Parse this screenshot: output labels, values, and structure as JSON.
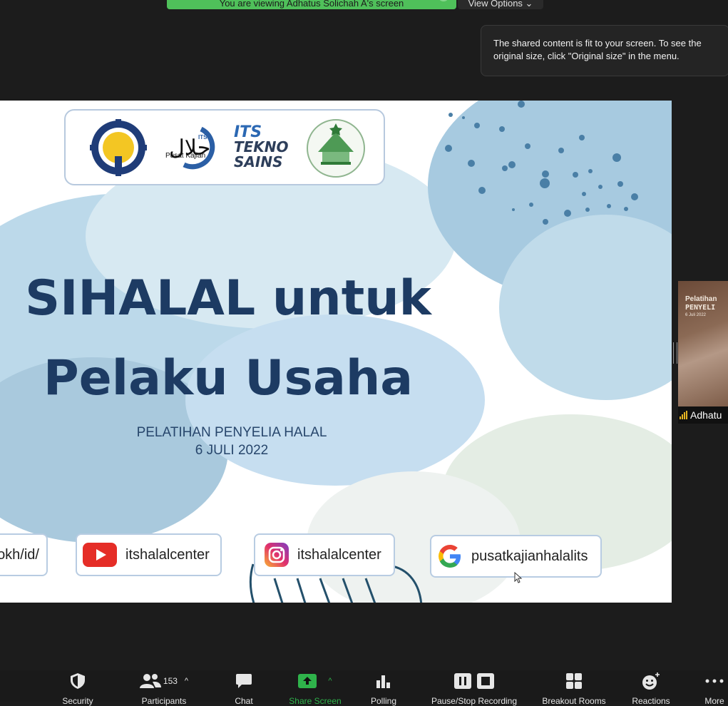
{
  "banner": {
    "text": "You are viewing Adhatus Solichah A's screen",
    "options": "View Options ⌄"
  },
  "tooltip": {
    "text": "The shared content is fit to your screen. To see the original size, click \"Original size\" in the menu."
  },
  "slide": {
    "logos": {
      "its_line1": "ITS",
      "its_line2": "TEKNO",
      "its_line3": "SAINS",
      "halal_caption": "Pusat Kajian"
    },
    "title_line1": "SIHALAL untuk",
    "title_line2": "Pelaku Usaha",
    "subtitle_line1": "PELATIHAN PENYELIA HALAL",
    "subtitle_line2": "6 JULI 2022",
    "socials": {
      "website": "okh/id/",
      "youtube": "itshalalcenter",
      "instagram": "itshalalcenter",
      "google": "pusatkajianhalalits"
    }
  },
  "participant": {
    "name": "Adhatu",
    "thumb_line1": "Pelatihan",
    "thumb_line2": "PENYELI",
    "thumb_line3": "6 Juli 2022"
  },
  "toolbar": {
    "security": "Security",
    "participants": "Participants",
    "participants_count": "153",
    "chat": "Chat",
    "share_screen": "Share Screen",
    "polling": "Polling",
    "recording": "Pause/Stop Recording",
    "breakout": "Breakout Rooms",
    "reactions": "Reactions",
    "more": "More"
  },
  "colors": {
    "share_green": "#2fb34b",
    "title_navy": "#1d3b63",
    "banner_green": "#4fc05a"
  }
}
